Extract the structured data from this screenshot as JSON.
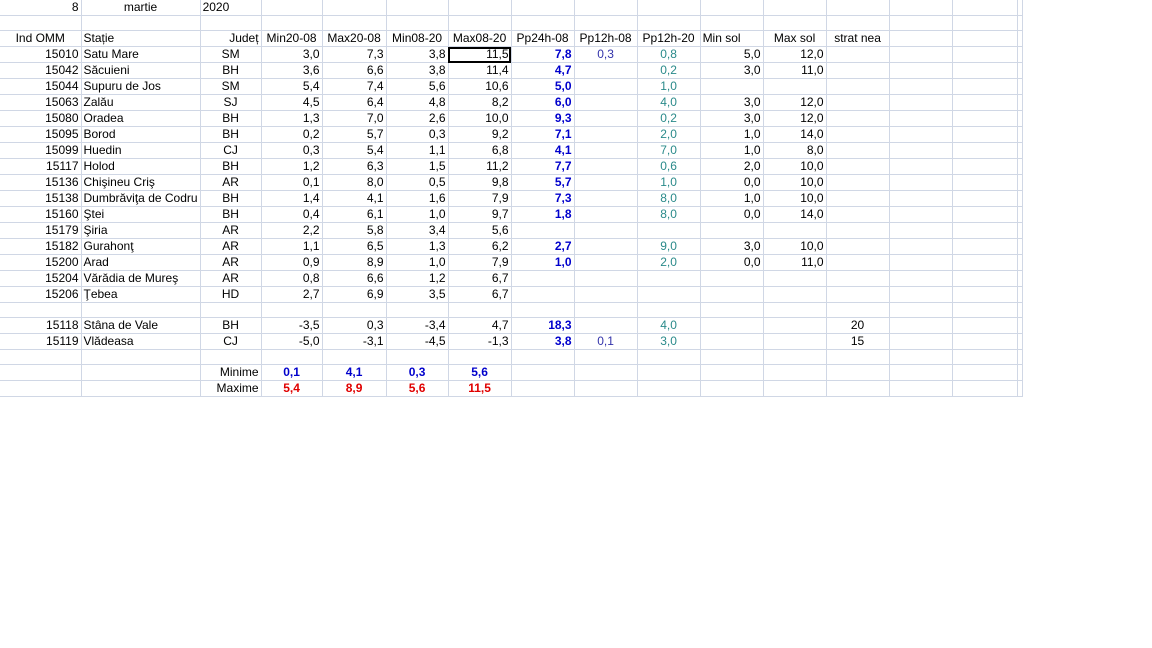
{
  "date": {
    "day": "8",
    "month": "martie",
    "year": "2020"
  },
  "headers": [
    "Ind OMM",
    "Stație",
    "Județ",
    "Min20-08",
    "Max20-08",
    "Min08-20",
    "Max08-20",
    "Pp24h-08",
    "Pp12h-08",
    "Pp12h-20",
    "Min sol",
    "Max sol",
    "strat nea"
  ],
  "rows": [
    [
      "15010",
      "Satu Mare",
      "SM",
      "3,0",
      "7,3",
      "3,8",
      "11,5",
      "7,8",
      "0,3",
      "0,8",
      "5,0",
      "12,0",
      ""
    ],
    [
      "15042",
      "Săcuieni",
      "BH",
      "3,6",
      "6,6",
      "3,8",
      "11,4",
      "4,7",
      "",
      "0,2",
      "3,0",
      "11,0",
      ""
    ],
    [
      "15044",
      "Supuru de Jos",
      "SM",
      "5,4",
      "7,4",
      "5,6",
      "10,6",
      "5,0",
      "",
      "1,0",
      "",
      "",
      ""
    ],
    [
      "15063",
      "Zalău",
      "SJ",
      "4,5",
      "6,4",
      "4,8",
      "8,2",
      "6,0",
      "",
      "4,0",
      "3,0",
      "12,0",
      ""
    ],
    [
      "15080",
      "Oradea",
      "BH",
      "1,3",
      "7,0",
      "2,6",
      "10,0",
      "9,3",
      "",
      "0,2",
      "3,0",
      "12,0",
      ""
    ],
    [
      "15095",
      "Borod",
      "BH",
      "0,2",
      "5,7",
      "0,3",
      "9,2",
      "7,1",
      "",
      "2,0",
      "1,0",
      "14,0",
      ""
    ],
    [
      "15099",
      "Huedin",
      "CJ",
      "0,3",
      "5,4",
      "1,1",
      "6,8",
      "4,1",
      "",
      "7,0",
      "1,0",
      "8,0",
      ""
    ],
    [
      "15117",
      "Holod",
      "BH",
      "1,2",
      "6,3",
      "1,5",
      "11,2",
      "7,7",
      "",
      "0,6",
      "2,0",
      "10,0",
      ""
    ],
    [
      "15136",
      "Chişineu    Criş",
      "AR",
      "0,1",
      "8,0",
      "0,5",
      "9,8",
      "5,7",
      "",
      "1,0",
      "0,0",
      "10,0",
      ""
    ],
    [
      "15138",
      "Dumbrăviţa  de Codru",
      "BH",
      "1,4",
      "4,1",
      "1,6",
      "7,9",
      "7,3",
      "",
      "8,0",
      "1,0",
      "10,0",
      ""
    ],
    [
      "15160",
      "Ştei",
      "BH",
      "0,4",
      "6,1",
      "1,0",
      "9,7",
      "1,8",
      "",
      "8,0",
      "0,0",
      "14,0",
      ""
    ],
    [
      "15179",
      "Şiria",
      "AR",
      "2,2",
      "5,8",
      "3,4",
      "5,6",
      "",
      "",
      "",
      "",
      "",
      ""
    ],
    [
      "15182",
      "Gurahonţ",
      "AR",
      "1,1",
      "6,5",
      "1,3",
      "6,2",
      "2,7",
      "",
      "9,0",
      "3,0",
      "10,0",
      ""
    ],
    [
      "15200",
      "Arad",
      "AR",
      "0,9",
      "8,9",
      "1,0",
      "7,9",
      "1,0",
      "",
      "2,0",
      "0,0",
      "11,0",
      ""
    ],
    [
      "15204",
      "Vărădia de Mureş",
      "AR",
      "0,8",
      "6,6",
      "1,2",
      "6,7",
      "",
      "",
      "",
      "",
      "",
      ""
    ],
    [
      "15206",
      "Ţebea",
      "HD",
      "2,7",
      "6,9",
      "3,5",
      "6,7",
      "",
      "",
      "",
      "",
      "",
      ""
    ]
  ],
  "mountain_rows": [
    [
      "15118",
      "Stâna de Vale",
      "BH",
      "-3,5",
      "0,3",
      "-3,4",
      "4,7",
      "18,3",
      "",
      "4,0",
      "",
      "",
      "20"
    ],
    [
      "15119",
      "Vlădeasa",
      "CJ",
      "-5,0",
      "-3,1",
      "-4,5",
      "-1,3",
      "3,8",
      "0,1",
      "3,0",
      "",
      "",
      "15"
    ]
  ],
  "summary": {
    "min_label": "Minime",
    "max_label": "Maxime",
    "min_values": [
      "0,1",
      "4,1",
      "0,3",
      "5,6"
    ],
    "max_values": [
      "5,4",
      "8,9",
      "5,6",
      "11,5"
    ]
  },
  "colors": {
    "bold_blue": "#0000cc",
    "blue": "#3333aa",
    "teal": "#2a8a8a",
    "red": "#e00000",
    "gridline": "#d0d7e5"
  }
}
